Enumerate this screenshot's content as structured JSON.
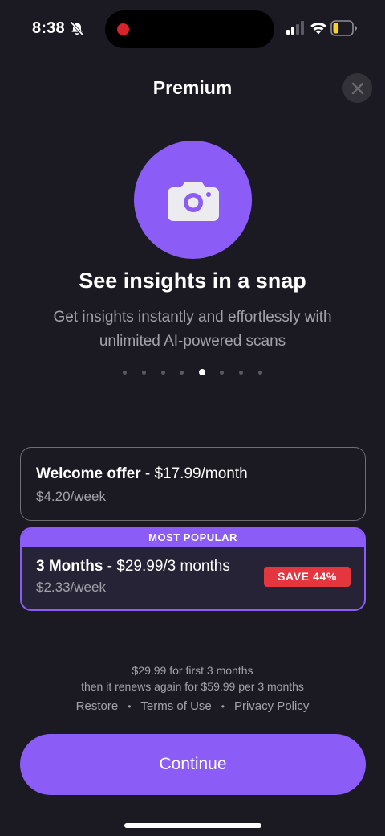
{
  "status_bar": {
    "time": "8:38",
    "battery_level": 0.3,
    "battery_color": "#f5d328"
  },
  "header": {
    "title": "Premium",
    "close_icon": "close-icon"
  },
  "hero": {
    "icon": "camera-icon",
    "title": "See insights in a snap",
    "subtitle": "Get insights instantly and effortlessly with unlimited AI-powered scans"
  },
  "carousel": {
    "total_pages": 8,
    "active_index": 4
  },
  "plans": [
    {
      "name": "Welcome offer",
      "price": "$17.99/month",
      "weekly": "$4.20/week"
    },
    {
      "banner": "MOST POPULAR",
      "name": "3 Months",
      "price": "$29.99/3 months",
      "weekly": "$2.33/week",
      "badge": "SAVE 44%"
    }
  ],
  "terms": {
    "line1": "$29.99 for first 3 months",
    "line2": "then it renews again for $59.99 per 3 months"
  },
  "links": {
    "restore": "Restore",
    "terms": "Terms of Use",
    "privacy": "Privacy Policy",
    "separator": "•"
  },
  "continue_label": "Continue",
  "colors": {
    "accent": "#8b5cf6",
    "background": "#1b1a23",
    "save_badge": "#e3363f"
  }
}
